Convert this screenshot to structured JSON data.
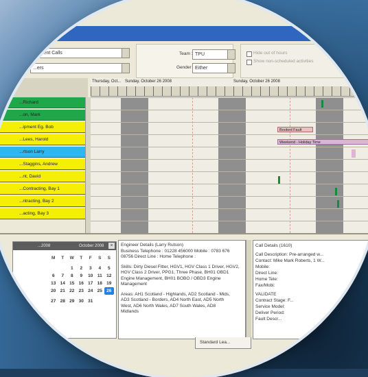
{
  "toolbar": {
    "combo1": "...ontent Calls",
    "combo2": "...ers",
    "team_label": "Team :",
    "team_value": "TPU",
    "gender_label": "Gender :",
    "gender_value": "Either",
    "opt1": "Hide out of hours",
    "opt2": "Show non-scheduled activities"
  },
  "timeline": {
    "day1": "Thursday, Oct...",
    "day2": "Sunday, October 26 2008",
    "day3": "Sunday, October 26 2008",
    "booking1": "Booked Fault",
    "booking2": "Weekend - Holiday Time"
  },
  "resources": [
    {
      "label": "...Richard",
      "color": "#1fa84a"
    },
    {
      "label": "...on, Mark",
      "color": "#1fa84a"
    },
    {
      "label": "...ipment Eg. Bob",
      "color": "#f5ef07"
    },
    {
      "label": "...Lees, Harold",
      "color": "#f5ef07"
    },
    {
      "label": "...rtson Larry",
      "color": "#2cb7ee"
    },
    {
      "label": "...Staggins, Andrew",
      "color": "#f5ef07"
    },
    {
      "label": "...nt, David",
      "color": "#f5ef07"
    },
    {
      "label": "...Contracting, Bay 1",
      "color": "#f5ef07"
    },
    {
      "label": "...ntracting, Bay 2",
      "color": "#f5ef07"
    },
    {
      "label": "...acting, Bay 3",
      "color": "#f5ef07"
    }
  ],
  "calendar": {
    "header_left": "...2008",
    "header_right": "October 2008",
    "weekdays": [
      "M",
      "T",
      "W",
      "T",
      "F",
      "S",
      "S"
    ],
    "days": [
      "",
      "",
      "1",
      "2",
      "3",
      "4",
      "5",
      "6",
      "7",
      "8",
      "9",
      "10",
      "11",
      "12",
      "13",
      "14",
      "15",
      "16",
      "17",
      "18",
      "19",
      "20",
      "21",
      "22",
      "23",
      "24",
      "25",
      "26",
      "27",
      "28",
      "29",
      "30",
      "31",
      "",
      ""
    ],
    "selected": "26"
  },
  "engineer": {
    "line1": "Engineer Details (Larry Rutson)",
    "line2": "Business Telephone : 01228 456000 Mobile : 0783 676",
    "line3": "08756 Direct Line : Home Telephone :",
    "line4": "Skills: Dirty Diesel Fitter, HGV1, HGV Class 1 Driver, HGV2,",
    "line5": "HGV Class 2 Driver, PPG1, Three Phase, BH01 OBD1",
    "line6": "Engine Management, BH01 BOBO / OBD3 Engine",
    "line7": "Management",
    "line8": "Areas: AH1 Scotland - Highlands, AD2 Scotland - Mids,",
    "line9": "AD3 Scotland - Borders, AD4 North East, AD5 North",
    "line10": "West, AD6 North Wales, AD7 South Wales, AD8",
    "line11": "Midlands"
  },
  "call": {
    "line1": "Call Details (1610)",
    "line2": "Call Description: Pre-arranged w...",
    "line3": "Contact: Mike Mark Roberts, 1 W...",
    "line4": "Mobile:",
    "line5": "Direct Line:",
    "line6": "Home Tele:",
    "line7": "Fax/Mobi:",
    "line8": "VALIDATE",
    "line9": "Contract Stage: F...",
    "line10": "Service Model:",
    "line11": "Deliver Period:",
    "line12": "Fault Descr..."
  },
  "tabs": {
    "standard": "Standard Lea..."
  }
}
